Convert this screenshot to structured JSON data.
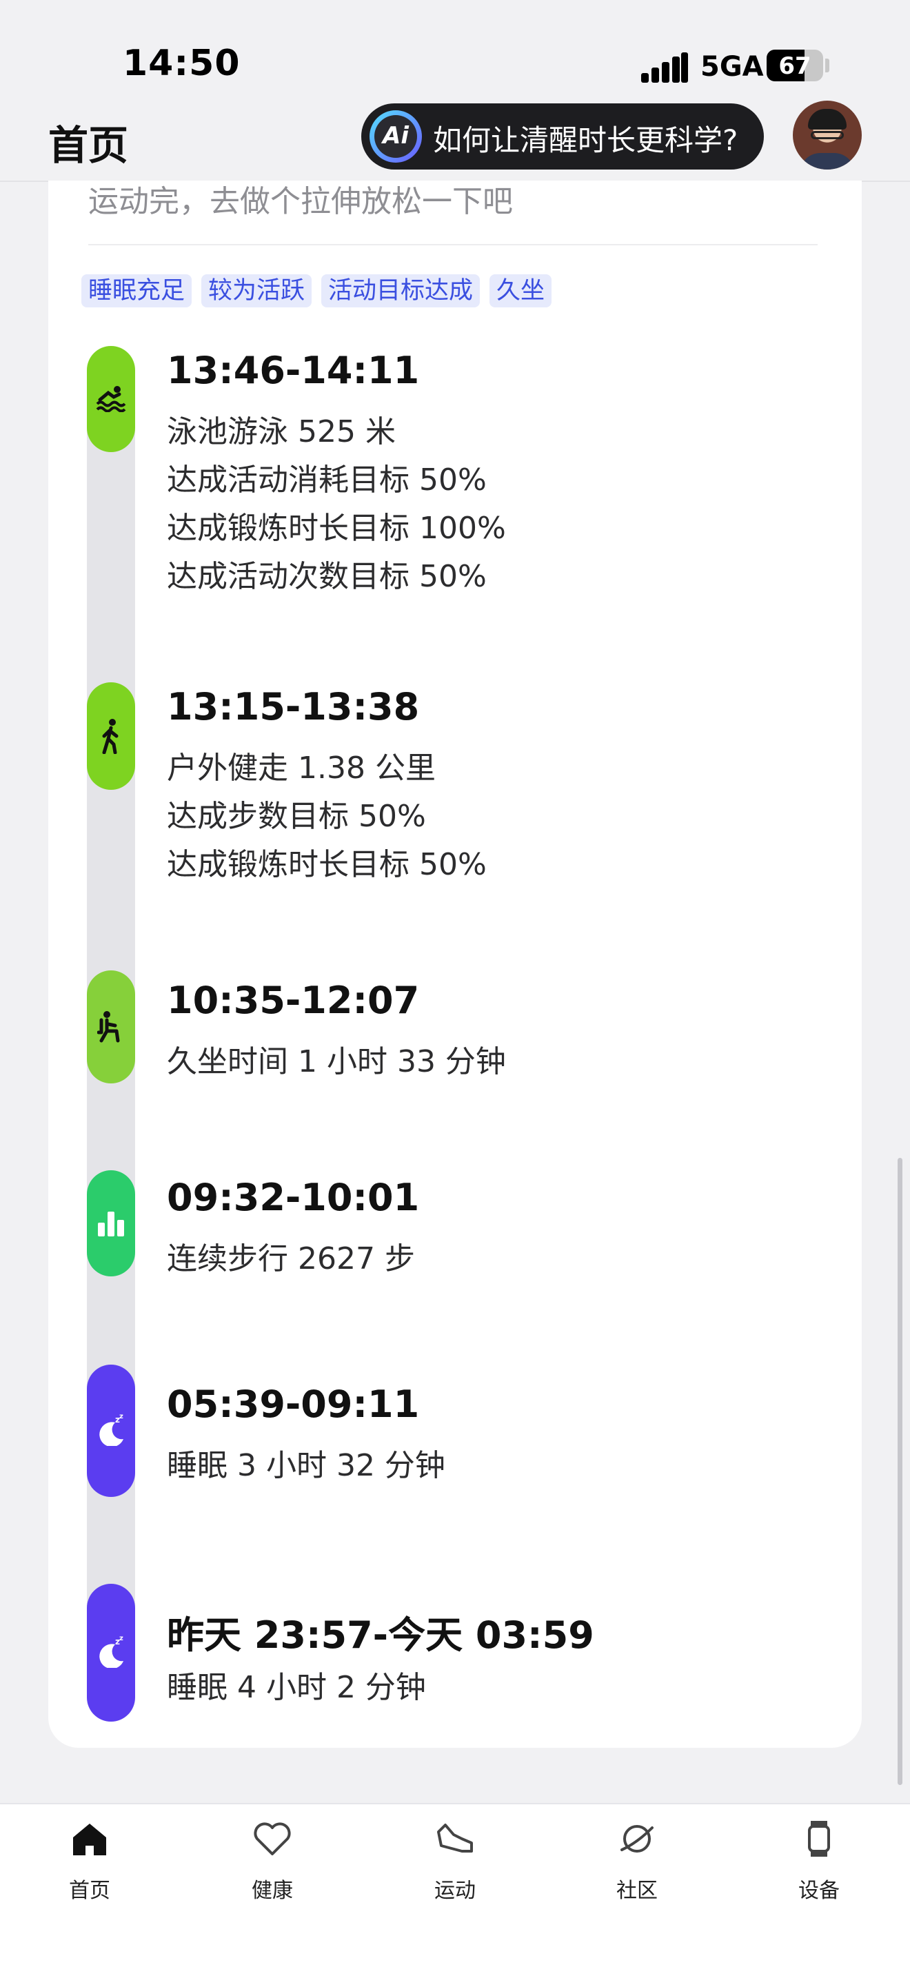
{
  "status_bar": {
    "time": "14:50",
    "network": "5GA",
    "battery_level": "67",
    "battery_fraction": 0.67
  },
  "header": {
    "title": "首页",
    "ai_prompt": "如何让清醒时长更科学?",
    "ai_logo": "Ai"
  },
  "card": {
    "tip": "运动完，去做个拉伸放松一下吧",
    "tags": [
      "睡眠充足",
      "较为活跃",
      "活动目标达成",
      "久坐"
    ]
  },
  "timeline": [
    {
      "time": "13:46-14:11",
      "icon": "swimming-icon",
      "color": "#7ed321",
      "lines": [
        "泳池游泳 525 米",
        "达成活动消耗目标 50%",
        "达成锻炼时长目标 100%",
        "达成活动次数目标 50%"
      ]
    },
    {
      "time": "13:15-13:38",
      "icon": "walking-icon",
      "color": "#7ed321",
      "lines": [
        "户外健走 1.38 公里",
        "达成步数目标 50%",
        "达成锻炼时长目标 50%"
      ]
    },
    {
      "time": "10:35-12:07",
      "icon": "sedentary-icon",
      "color": "#86d03a",
      "lines": [
        "久坐时间 1 小时 33 分钟"
      ]
    },
    {
      "time": "09:32-10:01",
      "icon": "steps-chart-icon",
      "color": "#2bcc6b",
      "lines": [
        "连续步行 2627 步"
      ]
    },
    {
      "time": "05:39-09:11",
      "icon": "sleep-moon-icon",
      "color": "#5b3df0",
      "lines": [
        "睡眠 3 小时 32 分钟"
      ]
    },
    {
      "time": "昨天 23:57-今天 03:59",
      "icon": "sleep-moon-icon",
      "color": "#5b3df0",
      "lines": [
        "睡眠 4 小时 2 分钟"
      ]
    }
  ],
  "bottom_nav": [
    {
      "label": "首页",
      "icon": "home-icon",
      "active": true
    },
    {
      "label": "健康",
      "icon": "heart-icon",
      "active": false
    },
    {
      "label": "运动",
      "icon": "shoe-icon",
      "active": false
    },
    {
      "label": "社区",
      "icon": "planet-icon",
      "active": false
    },
    {
      "label": "设备",
      "icon": "watch-icon",
      "active": false
    }
  ]
}
